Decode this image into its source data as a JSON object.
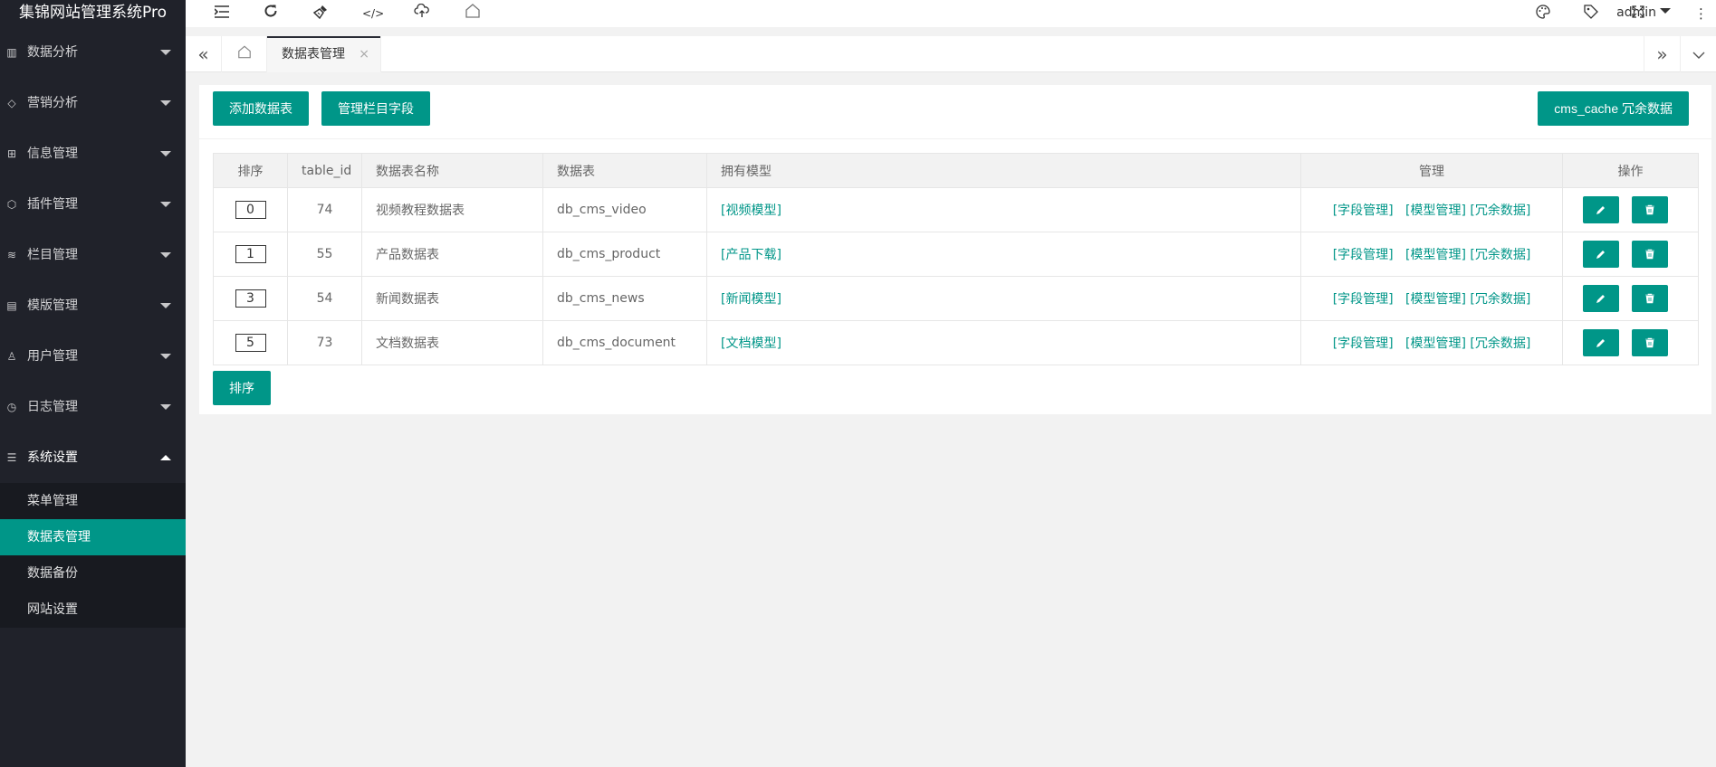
{
  "app": {
    "title": "集锦网站管理系统Pro"
  },
  "sidebar": {
    "items": [
      {
        "label": "数据分析",
        "icon": "chart-icon"
      },
      {
        "label": "营销分析",
        "icon": "diamond-icon"
      },
      {
        "label": "信息管理",
        "icon": "apps-icon"
      },
      {
        "label": "插件管理",
        "icon": "cube-icon"
      },
      {
        "label": "栏目管理",
        "icon": "layers-icon"
      },
      {
        "label": "模版管理",
        "icon": "template-icon"
      },
      {
        "label": "用户管理",
        "icon": "user-icon"
      },
      {
        "label": "日志管理",
        "icon": "clock-icon"
      },
      {
        "label": "系统设置",
        "icon": "sliders-icon"
      }
    ],
    "subitems": [
      {
        "label": "菜单管理"
      },
      {
        "label": "数据表管理"
      },
      {
        "label": "数据备份"
      },
      {
        "label": "网站设置"
      }
    ]
  },
  "header": {
    "user": "admin"
  },
  "tabs": {
    "current": "数据表管理",
    "close": "×"
  },
  "toolbar": {
    "add_label": "添加数据表",
    "fields_label": "管理栏目字段",
    "cache_label": "cms_cache 冗余数据"
  },
  "table": {
    "headers": [
      "排序",
      "table_id",
      "数据表名称",
      "数据表",
      "拥有模型",
      "管理",
      "操作"
    ],
    "rows": [
      {
        "sort": "0",
        "id": "74",
        "name": "视频教程数据表",
        "table": "db_cms_video",
        "model": "[视频模型]"
      },
      {
        "sort": "1",
        "id": "55",
        "name": "产品数据表",
        "table": "db_cms_product",
        "model": "[产品下载]"
      },
      {
        "sort": "3",
        "id": "54",
        "name": "新闻数据表",
        "table": "db_cms_news",
        "model": "[新闻模型]"
      },
      {
        "sort": "5",
        "id": "73",
        "name": "文档数据表",
        "table": "db_cms_document",
        "model": "[文档模型]"
      }
    ],
    "manage_links": {
      "fields": "[字段管理]",
      "models": "[模型管理]",
      "redundant": "[冗余数据]"
    }
  },
  "footer": {
    "sort_label": "排序"
  },
  "colors": {
    "accent": "#009688",
    "sidebar": "#20222a",
    "sidebar_sub": "#181a20"
  }
}
